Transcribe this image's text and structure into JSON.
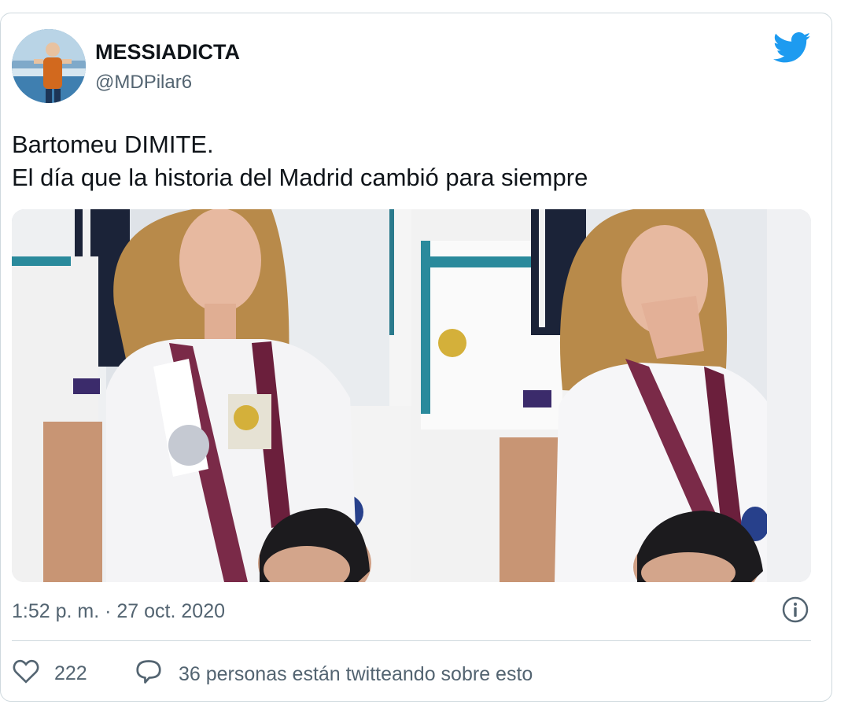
{
  "tweet": {
    "display_name": "MESSIADICTA",
    "handle": "@MDPilar6",
    "text_line1": "Bartomeu DIMITE.",
    "text_line2": "El día que la historia del Madrid cambió para siempre",
    "timestamp": "1:52 p. m. · 27 oct. 2020",
    "like_count": "222",
    "conversation_text": "36 personas están twitteando sobre esto"
  },
  "icons": {
    "brand": "twitter-bird-icon",
    "info": "info-icon",
    "like": "heart-icon",
    "reply": "speech-bubble-icon"
  },
  "colors": {
    "brand_blue": "#1d9bf0",
    "secondary_text": "#536471",
    "border": "#cfd9de"
  }
}
